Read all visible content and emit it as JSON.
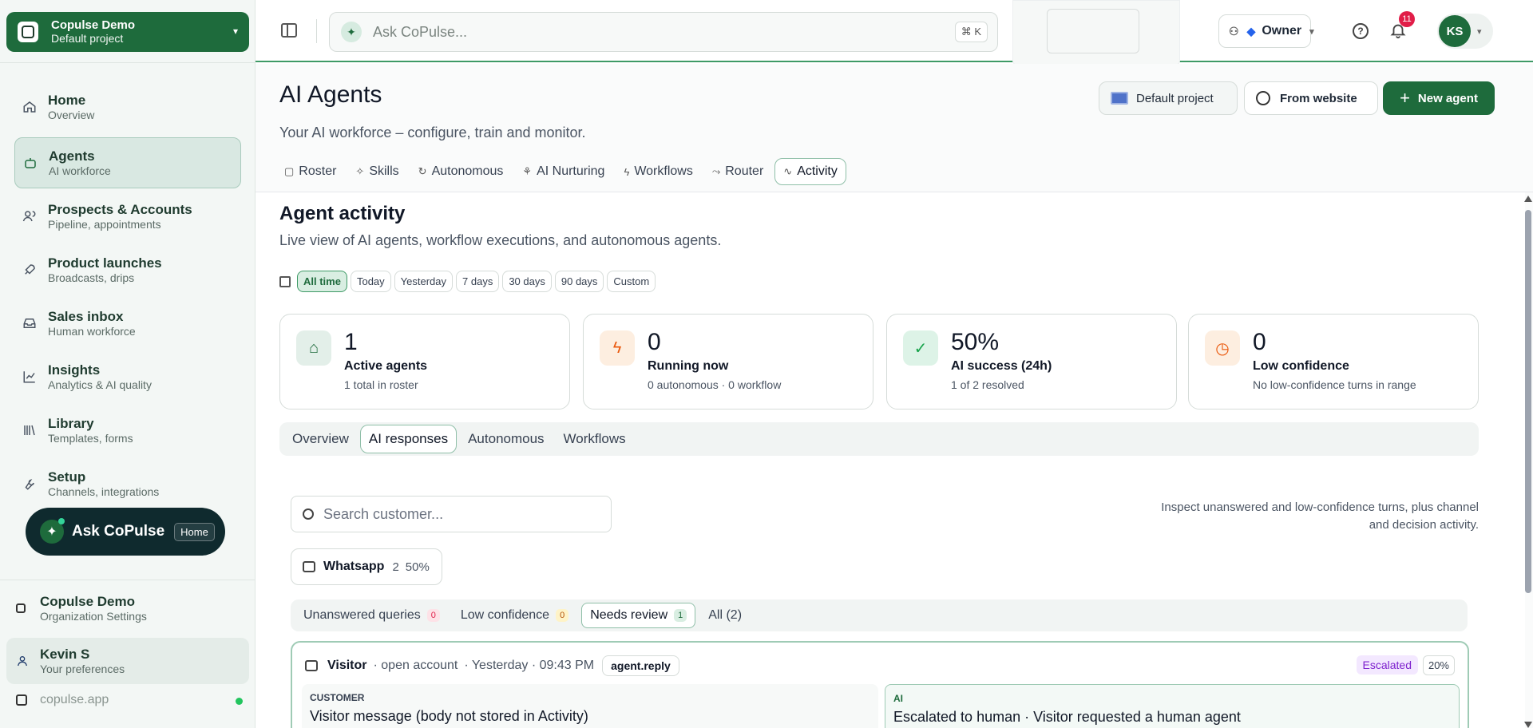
{
  "workspace": {
    "name": "Copulse Demo",
    "project": "Default project"
  },
  "nav": [
    {
      "label": "Home",
      "sub": "Overview",
      "icon": "home-icon"
    },
    {
      "label": "Agents",
      "sub": "AI workforce",
      "icon": "robot-icon"
    },
    {
      "label": "Prospects & Accounts",
      "sub": "Pipeline, appointments",
      "icon": "users-icon"
    },
    {
      "label": "Product launches",
      "sub": "Broadcasts, drips",
      "icon": "rocket-icon"
    },
    {
      "label": "Sales inbox",
      "sub": "Human workforce",
      "icon": "inbox-icon"
    },
    {
      "label": "Insights",
      "sub": "Analytics & AI quality",
      "icon": "chart-icon"
    },
    {
      "label": "Library",
      "sub": "Templates, forms",
      "icon": "library-icon"
    },
    {
      "label": "Setup",
      "sub": "Channels, integrations",
      "icon": "wrench-icon"
    }
  ],
  "ask": {
    "label": "Ask CoPulse",
    "badge": "Home"
  },
  "org": {
    "name": "Copulse Demo",
    "sub": "Organization Settings"
  },
  "user": {
    "name": "Kevin S",
    "sub": "Your preferences"
  },
  "domain": "copulse.app",
  "topbar": {
    "search_placeholder": "Ask CoPulse...",
    "shortcut": "⌘ K",
    "role": "Owner",
    "notifications": "11",
    "initials": "KS"
  },
  "header": {
    "title": "AI Agents",
    "subtitle": "Your AI workforce – configure, train and monitor.",
    "project_btn": "Default project",
    "website_btn": "From website",
    "new_btn": "New agent"
  },
  "tabs": [
    "Roster",
    "Skills",
    "Autonomous",
    "AI Nurturing",
    "Workflows",
    "Router",
    "Activity"
  ],
  "activity": {
    "title": "Agent activity",
    "subtitle": "Live view of AI agents, workflow executions, and autonomous agents.",
    "ranges": [
      "All time",
      "Today",
      "Yesterday",
      "7 days",
      "30 days",
      "90 days",
      "Custom"
    ]
  },
  "cards": [
    {
      "value": "1",
      "label": "Active agents",
      "sub": "1 total in roster",
      "icon": "robot-icon",
      "color": "#e3efe9"
    },
    {
      "value": "0",
      "label": "Running now",
      "sub": "0 autonomous · 0 workflow",
      "icon": "bolt-icon",
      "color": "#fdeee0"
    },
    {
      "value": "50%",
      "label": "AI success (24h)",
      "sub": "1 of 2 resolved",
      "icon": "check-circle-icon",
      "color": "#ddf3e7"
    },
    {
      "value": "0",
      "label": "Low confidence",
      "sub": "No low-confidence turns in range",
      "icon": "clock-icon",
      "color": "#fdeee0"
    }
  ],
  "subtabs": [
    "Overview",
    "AI responses",
    "Autonomous",
    "Workflows"
  ],
  "customer_search": "Search customer...",
  "note": "Inspect unanswered and low-confidence turns, plus channel and decision activity.",
  "channel": {
    "name": "Whatsapp",
    "count": "2",
    "pct": "50%"
  },
  "queues": [
    {
      "label": "Unanswered queries",
      "count": "0"
    },
    {
      "label": "Low confidence",
      "count": "0"
    },
    {
      "label": "Needs review",
      "count": "1"
    },
    {
      "label": "All (2)",
      "count": ""
    }
  ],
  "conversation": {
    "who": "Visitor",
    "context": "· open account",
    "time": "· Yesterday · 09:43 PM",
    "tag": "agent.reply",
    "status": "Escalated",
    "confidence": "20%",
    "customer_label": "CUSTOMER",
    "customer_text": "Visitor message (body not stored in Activity)",
    "ai_label": "AI",
    "ai_text": "Escalated to human · Visitor requested a human agent"
  }
}
